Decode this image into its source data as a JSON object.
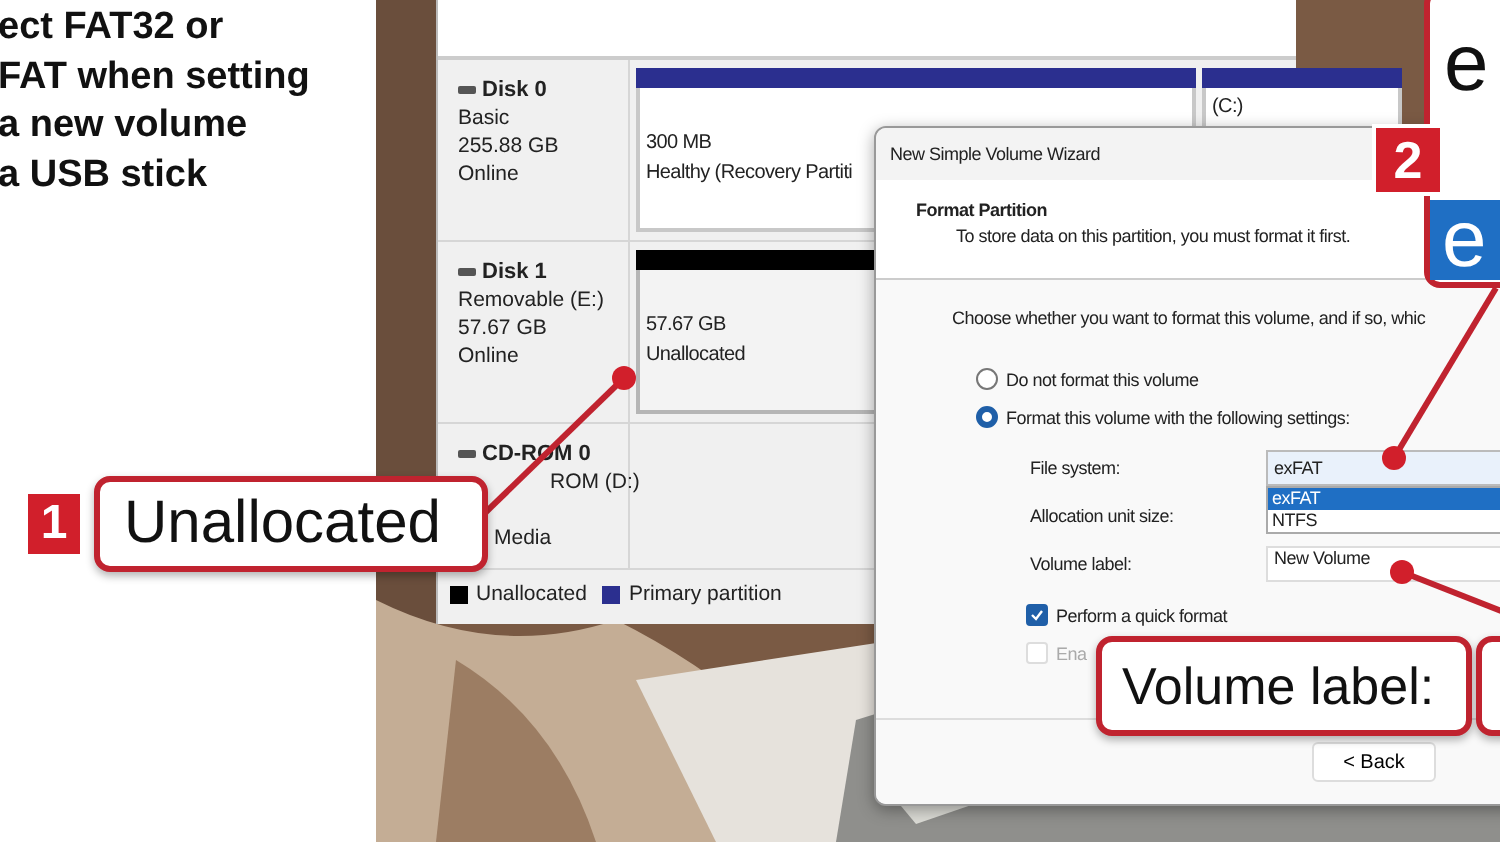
{
  "caption": {
    "lines": [
      "ect FAT32 or",
      "FAT when setting",
      "a new volume",
      "a USB stick"
    ]
  },
  "disk_window": {
    "disks": [
      {
        "name": "Disk 0",
        "info": [
          "Basic",
          "255.88 GB",
          "Online"
        ],
        "partitions": [
          {
            "color": "#2b2f8f",
            "lines": [
              "300 MB",
              "Healthy (Recovery Partiti"
            ]
          },
          {
            "color": "#2b2f8f",
            "lines": [
              "(C:)"
            ]
          }
        ]
      },
      {
        "name": "Disk 1",
        "info": [
          "Removable (E:)",
          "57.67 GB",
          "Online"
        ],
        "partitions": [
          {
            "color": "#000000",
            "lines": [
              "57.67 GB",
              "Unallocated"
            ]
          }
        ]
      },
      {
        "name": "CD-ROM 0",
        "info": [
          "ROM (D:)",
          "Media"
        ]
      }
    ],
    "legend": [
      {
        "label": "Unallocated",
        "color": "#000000"
      },
      {
        "label": "Primary partition",
        "color": "#2b2f8f"
      }
    ]
  },
  "dialog": {
    "title": "New Simple Volume Wizard",
    "heading": "Format Partition",
    "subheading": "To store data on this partition, you must format it first.",
    "prompt": "Choose whether you want to format this volume, and if so, whic",
    "radios": [
      {
        "label": "Do not format this volume",
        "selected": false
      },
      {
        "label": "Format this volume with the following settings:",
        "selected": true
      }
    ],
    "fields": [
      {
        "label": "File system:",
        "kind": "dropdown",
        "value": "exFAT",
        "expanded": true,
        "options": [
          {
            "label": "exFAT",
            "selected": true
          },
          {
            "label": "NTFS",
            "selected": false
          }
        ]
      },
      {
        "label": "Allocation unit size:",
        "kind": "label"
      },
      {
        "label": "Volume label:",
        "kind": "text",
        "value": "New Volume"
      }
    ],
    "checkboxes": [
      {
        "label": "Perform a quick format",
        "checked": true,
        "disabled": false
      },
      {
        "label": "Ena",
        "checked": false,
        "disabled": true
      }
    ],
    "buttons": [
      "< Back"
    ]
  },
  "callouts": [
    {
      "kind": "badge",
      "number": "1",
      "text": "Unallocated"
    },
    {
      "kind": "zoom",
      "number": "2",
      "texts": [
        "e",
        "e"
      ]
    },
    {
      "kind": "plain",
      "text": "Volume label:"
    }
  ]
}
